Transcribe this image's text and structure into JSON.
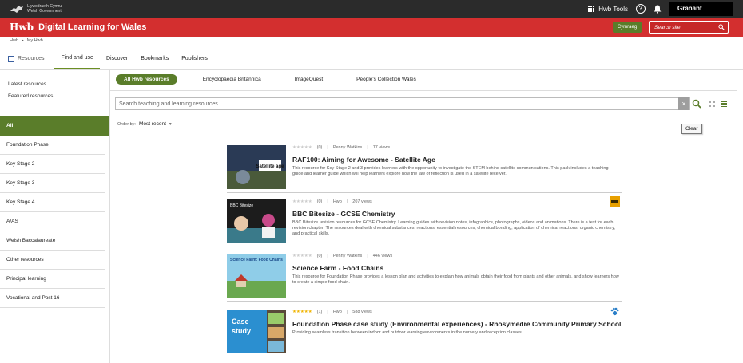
{
  "gov": {
    "line1": "Llywodraeth Cymru",
    "line2": "Welsh Government"
  },
  "topbar": {
    "tools_label": "Hwb Tools",
    "help": "?",
    "user_name": "Granant"
  },
  "header": {
    "brand": "Hwb",
    "title": "Digital Learning for Wales",
    "lang_button": "Cymraeg",
    "search_placeholder": "Search site"
  },
  "breadcrumb": {
    "home": "Hwb",
    "current": "My Hwb",
    "sep": "▸"
  },
  "tabs": {
    "resources": "Resources",
    "items": [
      "Find and use",
      "Discover",
      "Bookmarks",
      "Publishers"
    ]
  },
  "sidebar": {
    "latest": "Latest resources",
    "featured": "Featured resources",
    "categories": [
      "All",
      "Foundation Phase",
      "Key Stage 2",
      "Key Stage 3",
      "Key Stage 4",
      "A/AS",
      "Welsh Baccalaureate",
      "Other resources",
      "Principal learning",
      "Vocational and Post 16"
    ]
  },
  "chips": [
    "All Hwb resources",
    "Encyclopaedia Britannica",
    "ImageQuest",
    "People's Collection Wales"
  ],
  "search": {
    "placeholder": "Search teaching and learning resources",
    "clear_tooltip": "Clear"
  },
  "order": {
    "label": "Order by:",
    "value": "Most recent"
  },
  "colors": {
    "accent_green": "#5a7d2a",
    "hwb_red": "#d32f2f"
  },
  "results": [
    {
      "rating_stars": "★★★★★",
      "rating_count": "(0)",
      "author": "Penny Watkins",
      "views": "17 views",
      "title": "RAF100: Aiming for Awesome - Satellite Age",
      "thumb_label": "Satellite age",
      "desc": "This resource for Key Stage 2 and 3 provides learners with the opportunity to investigate the STEM behind satellite communications. This pack includes a teaching guide and learner guide which will help learners explore how the law of reflection is used in a satellite receiver."
    },
    {
      "rating_stars": "★★★★★",
      "rating_count": "(0)",
      "author": "Hwb",
      "views": "207 views",
      "title": "BBC Bitesize - GCSE Chemistry",
      "thumb_label": "BBC Bitesize",
      "desc": "BBC Bitesize revision resources for GCSE Chemistry. Learning guides with revision notes, infographics, photographs, videos and animations. There is a test for each revision chapter. The resources deal with chemical substances, reactions, essential resources, chemical bonding, application of chemical reactions, organic chemistry, and practical skills."
    },
    {
      "rating_stars": "★★★★★",
      "rating_count": "(0)",
      "author": "Penny Watkins",
      "views": "446 views",
      "title": "Science Farm - Food Chains",
      "thumb_label": "Science Farm: Food Chains",
      "desc": "This resource for Foundation Phase provides a lesson plan and activities to explain how animals obtain their food from plants and other animals, and show learners how to create a simple food chain."
    },
    {
      "rating_stars": "★★★★★",
      "rating_count": "(1)",
      "author": "Hwb",
      "views": "588 views",
      "title": "Foundation Phase case study (Environmental experiences) - Rhosymedre Community Primary School",
      "thumb_label": "Case study",
      "desc": "Providing seamless transition between indoor and outdoor learning environments in the nursery and reception classes."
    }
  ]
}
